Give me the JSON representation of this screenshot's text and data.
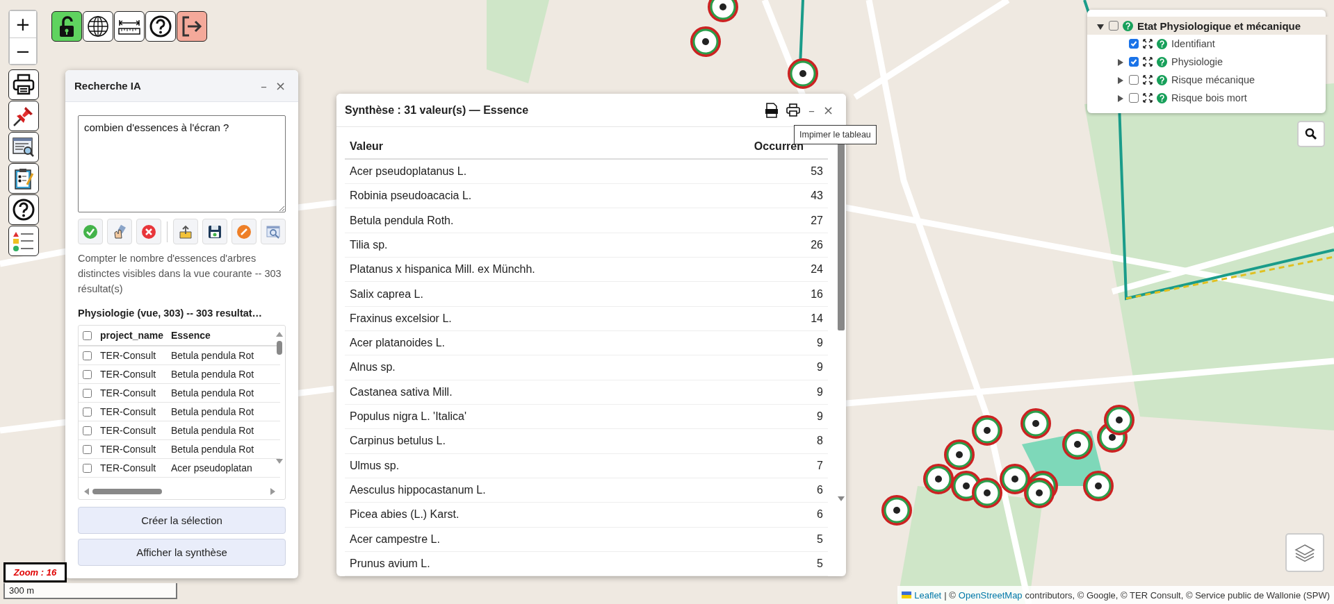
{
  "zoom_control": {
    "zoom_in": "+",
    "zoom_out": "−"
  },
  "top_toolbar": [
    {
      "kind": "unlock"
    },
    {
      "kind": "globe"
    },
    {
      "kind": "ruler"
    },
    {
      "kind": "help"
    },
    {
      "kind": "logout"
    }
  ],
  "side_toolbar": [
    {
      "kind": "print"
    },
    {
      "kind": "pin"
    },
    {
      "kind": "table-search"
    },
    {
      "kind": "checklist"
    },
    {
      "kind": "help"
    },
    {
      "kind": "legend"
    }
  ],
  "search_panel": {
    "title": "Recherche IA",
    "minimize": "–",
    "close": "×",
    "query": "combien d'essences à l'écran ?",
    "actions": [
      {
        "kind": "validate"
      },
      {
        "kind": "clear"
      },
      {
        "kind": "cancel"
      },
      {
        "kind": "upload"
      },
      {
        "kind": "save"
      },
      {
        "kind": "edit"
      },
      {
        "kind": "inspect"
      }
    ],
    "description": "Compter le nombre d'essences d'arbres distinctes visibles dans la vue courante -- 303 résultat(s)",
    "results_title": "Physiologie (vue, 303) -- 303 resultat…",
    "results_table": {
      "header_checked": false,
      "columns": [
        "project_name",
        "Essence"
      ],
      "rows": [
        {
          "checked": false,
          "cells": [
            "TER-Consult",
            "Betula pendula Rot"
          ]
        },
        {
          "checked": false,
          "cells": [
            "TER-Consult",
            "Betula pendula Rot"
          ]
        },
        {
          "checked": false,
          "cells": [
            "TER-Consult",
            "Betula pendula Rot"
          ]
        },
        {
          "checked": false,
          "cells": [
            "TER-Consult",
            "Betula pendula Rot"
          ]
        },
        {
          "checked": false,
          "cells": [
            "TER-Consult",
            "Betula pendula Rot"
          ]
        },
        {
          "checked": false,
          "cells": [
            "TER-Consult",
            "Betula pendula Rot"
          ]
        },
        {
          "checked": false,
          "cells": [
            "TER-Consult",
            "Acer pseudoplatan"
          ]
        }
      ]
    },
    "buttons": [
      "Créer la sélection",
      "Afficher la synthèse"
    ]
  },
  "synthesis_panel": {
    "title": "Synthèse : 31 valeur(s) — Essence",
    "minimize": "–",
    "close": "×",
    "columns": [
      "Valeur",
      "Occurren"
    ],
    "rows": [
      [
        "Acer pseudoplatanus L.",
        "53"
      ],
      [
        "Robinia pseudoacacia L.",
        "43"
      ],
      [
        "Betula pendula Roth.",
        "27"
      ],
      [
        "Tilia sp.",
        "26"
      ],
      [
        "Platanus x hispanica Mill. ex Münchh.",
        "24"
      ],
      [
        "Salix caprea L.",
        "16"
      ],
      [
        "Fraxinus excelsior L.",
        "14"
      ],
      [
        "Acer platanoides L.",
        "9"
      ],
      [
        "Alnus sp.",
        "9"
      ],
      [
        "Castanea sativa Mill.",
        "9"
      ],
      [
        "Populus nigra L. 'Italica'",
        "9"
      ],
      [
        "Carpinus betulus L.",
        "8"
      ],
      [
        "Ulmus sp.",
        "7"
      ],
      [
        "Aesculus hippocastanum L.",
        "6"
      ],
      [
        "Picea abies (L.) Karst.",
        "6"
      ],
      [
        "Acer campestre L.",
        "5"
      ],
      [
        "Prunus avium L.",
        "5"
      ]
    ],
    "tooltip": "Impimer le tableau"
  },
  "layer_tree": {
    "label": "Etat Physiologique et mécanique",
    "expanded": true,
    "checked": false,
    "children": [
      {
        "kind": "leaf",
        "label": "Identifiant",
        "checked": true
      },
      {
        "kind": "group",
        "label": "Physiologie",
        "checked": true,
        "expanded": false
      },
      {
        "kind": "group",
        "label": "Risque mécanique",
        "checked": false,
        "expanded": false
      },
      {
        "kind": "group",
        "label": "Risque bois mort",
        "checked": false,
        "expanded": false
      }
    ]
  },
  "zoom_label": "Zoom : 16",
  "scale": "300 m",
  "attribution": [
    {
      "kind": "link",
      "text": "Leaflet"
    },
    {
      "kind": "text",
      "text": "| ©"
    },
    {
      "kind": "link",
      "text": "OpenStreetMap"
    },
    {
      "kind": "text",
      "text": "contributors, © Google, © TER Consult, © Service public de Wallonie (SPW)"
    }
  ]
}
